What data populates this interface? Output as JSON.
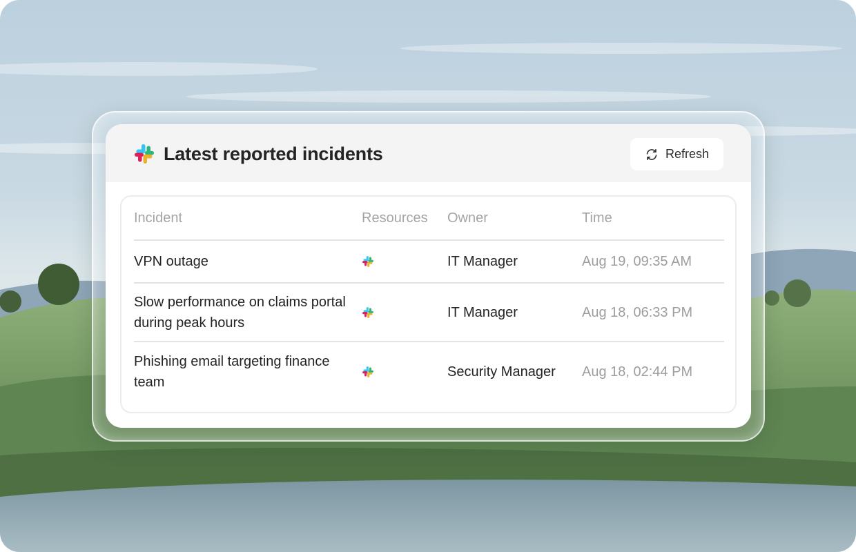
{
  "card": {
    "title": "Latest reported incidents",
    "logo_icon": "slack-logo-icon",
    "refresh_label": "Refresh",
    "refresh_icon": "refresh-icon"
  },
  "table": {
    "headers": {
      "incident": "Incident",
      "resources": "Resources",
      "owner": "Owner",
      "time": "Time"
    },
    "rows": [
      {
        "incident": "VPN outage",
        "resource_icon": "slack-icon",
        "owner": "IT Manager",
        "time": "Aug 19, 09:35 AM"
      },
      {
        "incident": "Slow performance on claims portal during peak hours",
        "resource_icon": "slack-icon",
        "owner": "IT Manager",
        "time": "Aug 18, 06:33 PM"
      },
      {
        "incident": "Phishing email targeting finance team",
        "resource_icon": "slack-icon",
        "owner": "Security Manager",
        "time": "Aug 18, 02:44 PM"
      }
    ]
  },
  "colors": {
    "slack_blue": "#36C5F0",
    "slack_green": "#2EB67D",
    "slack_red": "#E01E5A",
    "slack_yellow": "#ECB22E"
  }
}
